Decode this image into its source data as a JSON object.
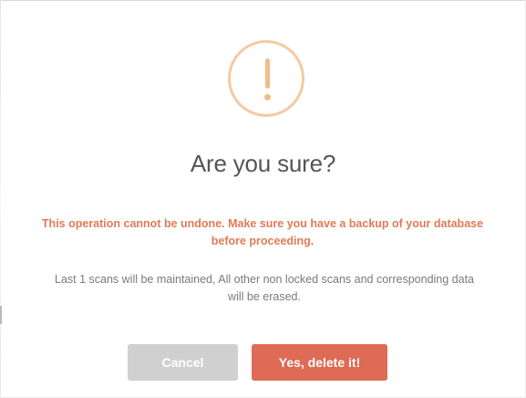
{
  "dialog": {
    "icon": "exclamation-warning-icon",
    "title": "Are you sure?",
    "warning": "This operation cannot be undone. Make sure you have a backup of your database before proceeding.",
    "info": "Last 1 scans will be maintained, All other non locked scans and corresponding data will be erased.",
    "buttons": {
      "cancel_label": "Cancel",
      "confirm_label": "Yes, delete it!"
    }
  },
  "colors": {
    "icon_outline": "#f5c9a2",
    "icon_mark": "#f3bb8a",
    "warning_text": "#e07b55",
    "confirm_button": "#dd6b55",
    "cancel_button": "#d0d0d0",
    "title_text": "#555555",
    "info_text": "#7a7a7a"
  }
}
